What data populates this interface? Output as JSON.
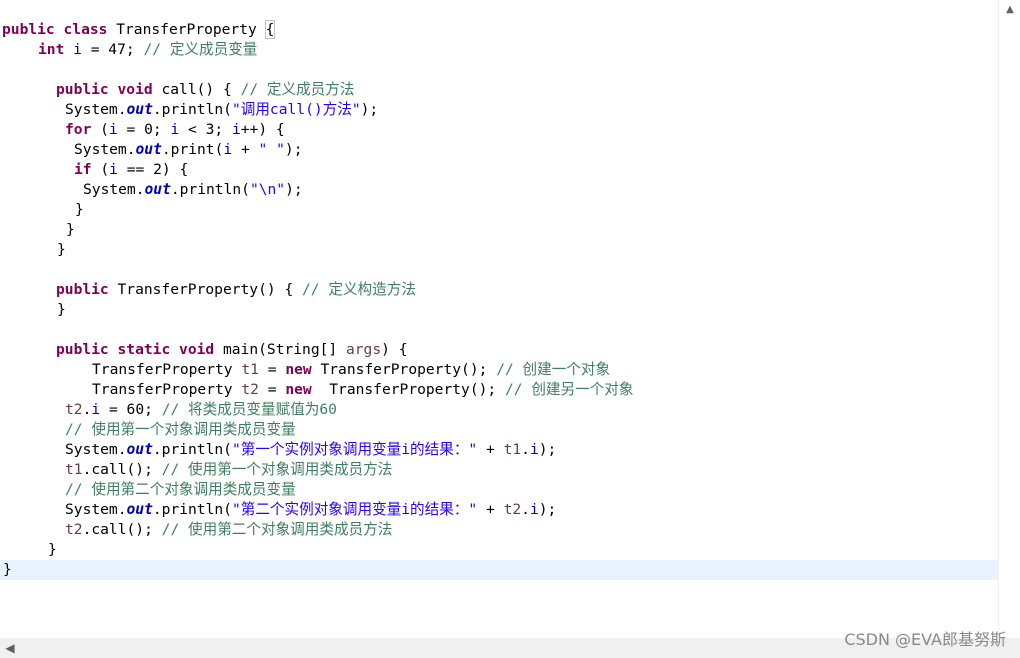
{
  "code": {
    "l01": {
      "kw1": "public",
      "kw2": "class",
      "name": " TransferProperty ",
      "brace": "{"
    },
    "l02": {
      "kw": "int",
      "field": "i",
      "rest": " = 47; ",
      "cmt": "// 定义成员变量"
    },
    "l04": {
      "kw1": "public",
      "kw2": "void",
      "rest": " call() { ",
      "cmt": "// 定义成员方法"
    },
    "l05": {
      "a": "System.",
      "out": "out",
      "b": ".println(",
      "str": "\"调用call()方法\"",
      "c": ");"
    },
    "l06": {
      "kw": "for",
      "a": " (",
      "f1": "i",
      "b": " = 0; ",
      "f2": "i",
      "c": " < 3; ",
      "f3": "i",
      "d": "++) {"
    },
    "l07": {
      "a": "System.",
      "out": "out",
      "b": ".print(",
      "f1": "i",
      "c": " + ",
      "str": "\" \"",
      "d": ");"
    },
    "l08": {
      "kw": "if",
      "a": " (",
      "f1": "i",
      "b": " == 2) {"
    },
    "l09": {
      "a": "System.",
      "out": "out",
      "b": ".println(",
      "str": "\"\\n\"",
      "c": ");"
    },
    "l10": {
      "a": "}"
    },
    "l11": {
      "a": "}"
    },
    "l12": {
      "a": "}"
    },
    "l14": {
      "kw": "public",
      "rest": " TransferProperty() { ",
      "cmt": "// 定义构造方法"
    },
    "l15": {
      "a": "}"
    },
    "l17": {
      "kw1": "public",
      "kw2": "static",
      "kw3": "void",
      "a": " main(String[] ",
      "local": "args",
      "b": ") {"
    },
    "l18": {
      "a": "TransferProperty ",
      "local": "t1",
      "b": " = ",
      "kw": "new",
      "c": " TransferProperty(); ",
      "cmt": "// 创建一个对象"
    },
    "l19": {
      "a": "TransferProperty ",
      "local": "t2",
      "b": " = ",
      "kw": "new",
      "c": "  TransferProperty(); ",
      "cmt": "// 创建另一个对象"
    },
    "l20": {
      "local": "t2",
      "a": ".",
      "field": "i",
      "b": " = 60; ",
      "cmt": "// 将类成员变量赋值为60"
    },
    "l21": {
      "cmt": "// 使用第一个对象调用类成员变量"
    },
    "l22": {
      "a": "System.",
      "out": "out",
      "b": ".println(",
      "str": "\"第一个实例对象调用变量i的结果：\"",
      "c": " + ",
      "local": "t1",
      "d": ".",
      "field": "i",
      "e": ");"
    },
    "l23": {
      "local": "t1",
      "a": ".call(); ",
      "cmt": "// 使用第一个对象调用类成员方法"
    },
    "l24": {
      "cmt": "// 使用第二个对象调用类成员变量"
    },
    "l25": {
      "a": "System.",
      "out": "out",
      "b": ".println(",
      "str": "\"第二个实例对象调用变量i的结果：\"",
      "c": " + ",
      "local": "t2",
      "d": ".",
      "field": "i",
      "e": ");"
    },
    "l26": {
      "local": "t2",
      "a": ".call(); ",
      "cmt": "// 使用第二个对象调用类成员方法"
    },
    "l27": {
      "a": "}"
    },
    "l28": {
      "a": "}"
    }
  },
  "watermark": "CSDN @EVA郎基努斯",
  "icons": {
    "scroll_up": "▲",
    "scroll_left": "◀"
  },
  "colors": {
    "keyword": "#7f0055",
    "field": "#0000c0",
    "string": "#2a00ff",
    "comment": "#3f7f5f",
    "local": "#6a3e3e",
    "current_line": "#e8f2fe"
  }
}
